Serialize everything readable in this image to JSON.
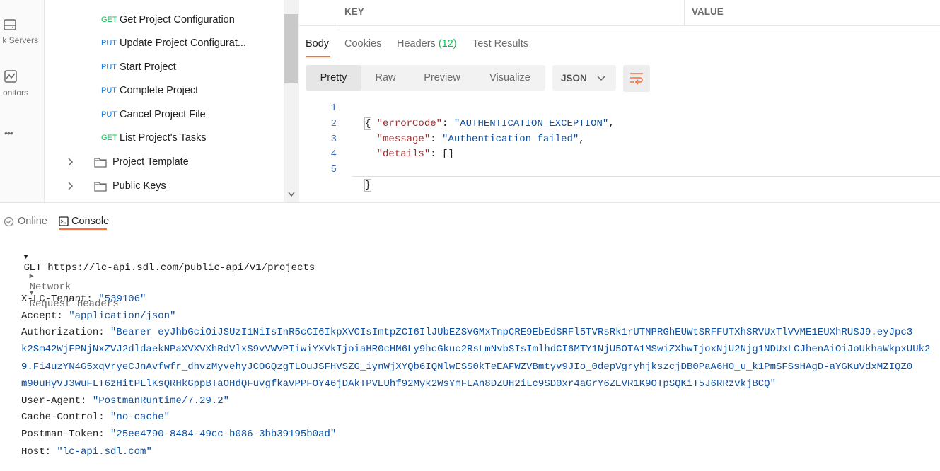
{
  "sidebar_rail": {
    "items": [
      {
        "label": "k Servers",
        "icon": "server-icon"
      },
      {
        "label": "onitors",
        "icon": "monitor-icon"
      },
      {
        "label": "•••",
        "icon": "more-icon"
      }
    ]
  },
  "tree": {
    "requests": [
      {
        "method": "GET",
        "name": "Get Project Configuration"
      },
      {
        "method": "PUT",
        "name": "Update Project Configurat..."
      },
      {
        "method": "PUT",
        "name": "Start Project"
      },
      {
        "method": "PUT",
        "name": "Complete Project"
      },
      {
        "method": "PUT",
        "name": "Cancel Project File"
      },
      {
        "method": "GET",
        "name": "List Project's Tasks"
      }
    ],
    "folders": [
      {
        "name": "Project Template"
      },
      {
        "name": "Public Keys"
      }
    ]
  },
  "params_table": {
    "key_header": "KEY",
    "value_header": "VALUE"
  },
  "response_tabs": {
    "body": "Body",
    "cookies": "Cookies",
    "headers": "Headers",
    "headers_count": "(12)",
    "test_results": "Test Results"
  },
  "view_modes": {
    "pretty": "Pretty",
    "raw": "Raw",
    "preview": "Preview",
    "visualize": "Visualize"
  },
  "format_select": {
    "value": "JSON"
  },
  "response_body": {
    "line_numbers": [
      "1",
      "2",
      "3",
      "4",
      "5"
    ],
    "open_brace": "{",
    "close_brace": "}",
    "fields": [
      {
        "key": "\"errorCode\"",
        "value": "\"AUTHENTICATION_EXCEPTION\"",
        "trail": ","
      },
      {
        "key": "\"message\"",
        "value": "\"Authentication failed\"",
        "trail": ","
      },
      {
        "key": "\"details\"",
        "value": "[]",
        "trail": ""
      }
    ]
  },
  "console": {
    "tabs": {
      "online": "Online",
      "console": "Console"
    },
    "request_line": "GET https://lc-api.sdl.com/public-api/v1/projects",
    "network_label": "Network",
    "request_headers_label": "Request Headers",
    "headers": [
      {
        "key": "X-LC-Tenant:",
        "value": "\"539106\""
      },
      {
        "key": "Accept:",
        "value": "\"application/json\""
      },
      {
        "key": "Authorization:",
        "value": "\"Bearer eyJhbGciOiJSUzI1NiIsInR5cCI6IkpXVCIsImtpZCI6IlJUbEZSVGMxTnpCRE9EbEdSRFl5TVRsRk1rUTNPRGhEUWtSRFFUTXhSRVUxTlVVME1EUXhRUSJ9.eyJpc3"
      },
      {
        "key": "",
        "value": "k2Sm42WjFPNjNxZVJ2dldaekNPaXVXVXhRdVlxS9vVWVPIiwiYXVkIjoiaHR0cHM6Ly9hcGkuc2RsLmNvbSIsImlhdCI6MTY1NjU5OTA1MSwiZXhwIjoxNjU2Njg1NDUxLCJhenAiOiJoUkhaWkpxUUk2"
      },
      {
        "key": "",
        "value": "9.Fi4uzYN4G5xqVryeCJnAvfwfr_dhvzMyvehyJCOGQzgTLOuJSFHVSZG_iynWjXYQb6IQNlwESS0kTeEAFWZVBmtyv9JIo_0depVgryhjkszcjDB0PaA6HO_u_k1PmSFSsHAgD-aYGKuVdxMZIQZ0"
      },
      {
        "key": "",
        "value": "m90uHyVJ3wuFLT6zHitPLlKsQRHkGppBTaOHdQFuvgfkaVPPFOY46jDAkTPVEUhf92Myk2WsYmFEAn8DZUH2iLc9SD0xr4aGrY6ZEVR1K9OTpSQKiT5J6RRzvkjBCQ\""
      },
      {
        "key": "User-Agent:",
        "value": "\"PostmanRuntime/7.29.2\""
      },
      {
        "key": "Cache-Control:",
        "value": "\"no-cache\""
      },
      {
        "key": "Postman-Token:",
        "value": "\"25ee4790-8484-49cc-b086-3bb39195b0ad\""
      },
      {
        "key": "Host:",
        "value": "\"lc-api.sdl.com\""
      }
    ]
  },
  "colors": {
    "accent": "#ff6c37",
    "get": "#0cbb52",
    "put": "#097bed",
    "json_key": "#a32c2c",
    "json_string": "#0a4fa3"
  }
}
